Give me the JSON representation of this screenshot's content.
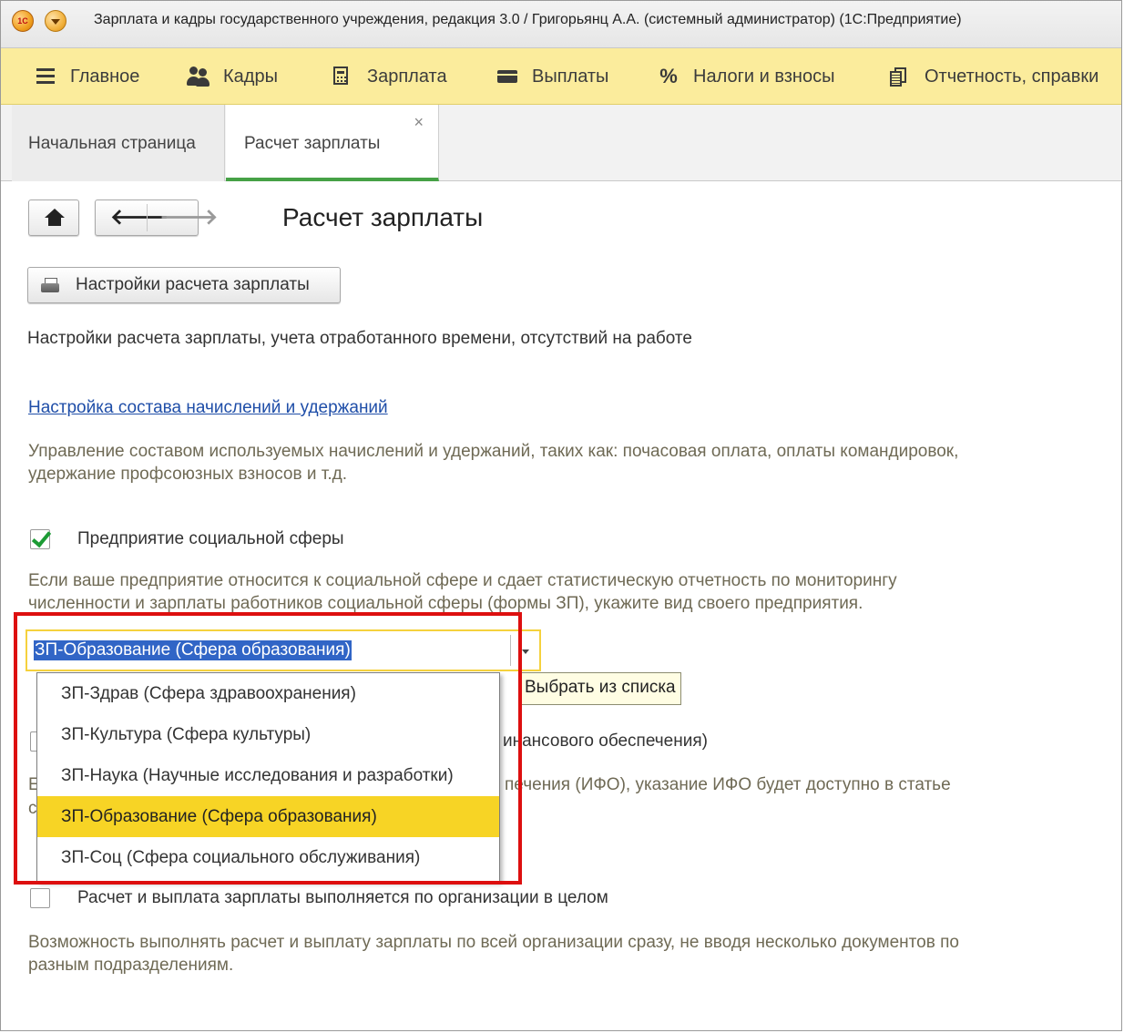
{
  "window": {
    "title": "Зарплата и кадры государственного учреждения, редакция 3.0 / Григорьянц А.А. (системный администратор)  (1С:Предприятие)",
    "logo_text": "1C"
  },
  "sections": [
    {
      "label": "Главное",
      "icon": "menu-lines-icon"
    },
    {
      "label": "Кадры",
      "icon": "people-icon"
    },
    {
      "label": "Зарплата",
      "icon": "calculator-icon"
    },
    {
      "label": "Выплаты",
      "icon": "card-icon"
    },
    {
      "label": "Налоги и взносы",
      "icon": "percent-icon"
    },
    {
      "label": "Отчетность, справки",
      "icon": "documents-icon"
    }
  ],
  "tabs": {
    "home": "Начальная страница",
    "active": "Расчет зарплаты",
    "close_glyph": "×",
    "active_indicator_color": "#46a146"
  },
  "form": {
    "title": "Расчет зарплаты",
    "nav": {
      "home_icon": "home-icon",
      "back_glyph": "🡐",
      "forward_glyph": "🡒"
    },
    "settings_button": "Настройки расчета зарплаты",
    "settings_description": "Настройки расчета зарплаты, учета отработанного времени, отсутствий на работе",
    "accruals_link": "Настройка состава начислений и удержаний",
    "accruals_hint_line1": "Управление составом используемых начислений и удержаний, таких как: почасовая оплата, оплаты командировок,",
    "accruals_hint_line2": "удержание профсоюзных взносов и т.д.",
    "social_checkbox": {
      "label": "Предприятие социальной сферы",
      "checked": true
    },
    "social_hint_line1": "Если ваше предприятие относится к социальной сфере и сдает статистическую отчетность по мониторингу",
    "social_hint_line2": "численности и зарплаты работников социальной сферы (формы ЗП), укажите вид своего предприятия.",
    "kind_select": {
      "value": "ЗП-Образование (Сфера образования)",
      "tooltip": "Выбрать из списка",
      "options": [
        "ЗП-Здрав (Сфера здравоохранения)",
        "ЗП-Культура (Сферa культуры)",
        "ЗП-Наука (Научные исследования и разработки)",
        "ЗП-Образование (Сфера образования)",
        "ЗП-Соц (Сфера социального обслуживания)"
      ],
      "selected_index": 3
    },
    "partial_behind_1": "инансового обеспечения)",
    "partial_behind_2": "печения (ИФО), указание ИФО будет доступно в статье",
    "partial_left_1": "Е",
    "partial_left_2": "с",
    "org_checkbox": {
      "label": "Расчет и выплата зарплаты выполняется по организации в целом",
      "checked": false
    },
    "org_hint_line1": "Возможность выполнять расчет и выплату зарплаты по всей организации сразу, не вводя несколько документов по",
    "org_hint_line2": "разным подразделениям."
  },
  "colors": {
    "section_bar": "#fbec9c",
    "selection_blue": "#3165c6",
    "selected_option": "#f7d425",
    "highlight_frame": "#dd0f0f",
    "link": "#1f4ea8",
    "hint_text": "#6f6a55"
  }
}
